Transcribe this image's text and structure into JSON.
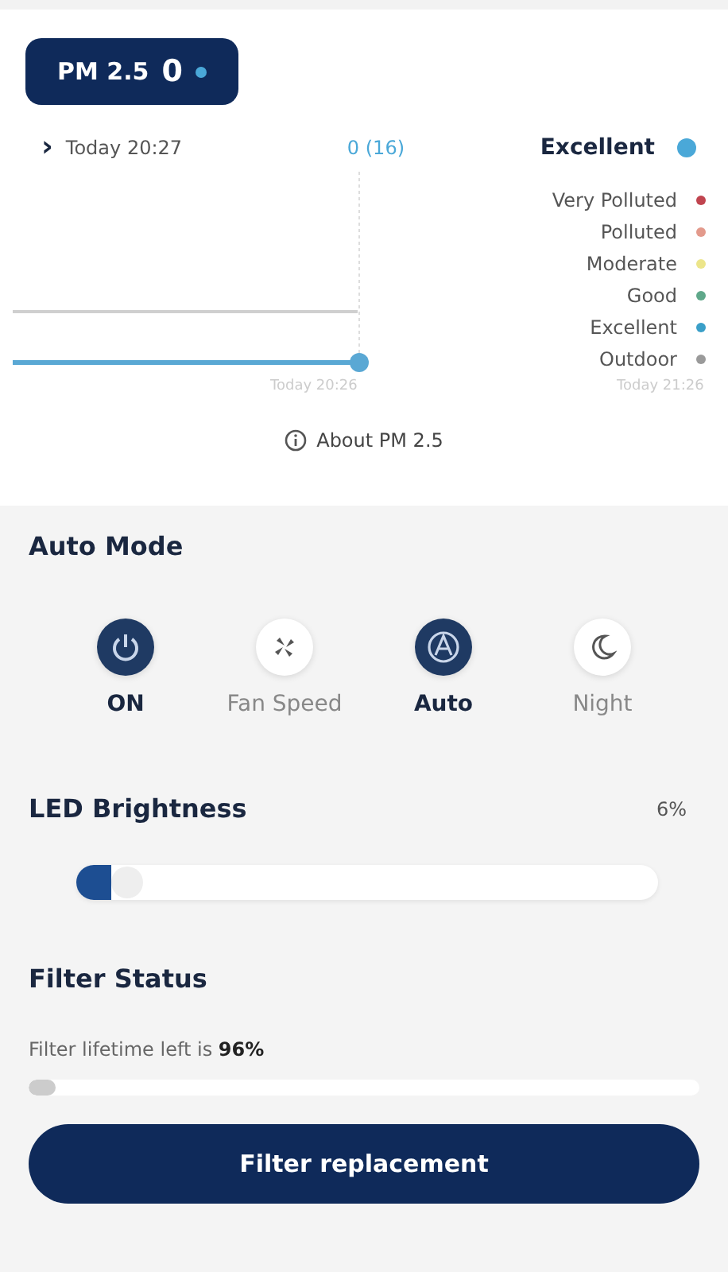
{
  "badge": {
    "label": "PM 2.5",
    "value": "0"
  },
  "reading": {
    "chevron": "›",
    "time": "Today 20:27",
    "value": "0 (16)",
    "status": "Excellent"
  },
  "legend": [
    {
      "label": "Very Polluted",
      "color": "#c0444f"
    },
    {
      "label": "Polluted",
      "color": "#e39a8c"
    },
    {
      "label": "Moderate",
      "color": "#ece58a"
    },
    {
      "label": "Good",
      "color": "#5fa88a"
    },
    {
      "label": "Excellent",
      "color": "#3a9fc8"
    },
    {
      "label": "Outdoor",
      "color": "#9a9a9a"
    }
  ],
  "chart": {
    "x_labels": [
      "Today 20:26",
      "Today 21:26"
    ]
  },
  "about_link": "About PM 2.5",
  "auto_mode": {
    "title": "Auto Mode",
    "modes": [
      {
        "kind": "power",
        "label": "ON",
        "selected": true
      },
      {
        "kind": "fan",
        "label": "Fan Speed",
        "selected": false
      },
      {
        "kind": "auto",
        "label": "Auto",
        "selected": true
      },
      {
        "kind": "night",
        "label": "Night",
        "selected": false
      }
    ]
  },
  "led": {
    "title": "LED Brightness",
    "reading": "6%",
    "level": 0.06
  },
  "filter": {
    "title": "Filter Status",
    "text": "Filter lifetime left is **96%**",
    "level": 0.04,
    "button": "Filter replacement"
  }
}
